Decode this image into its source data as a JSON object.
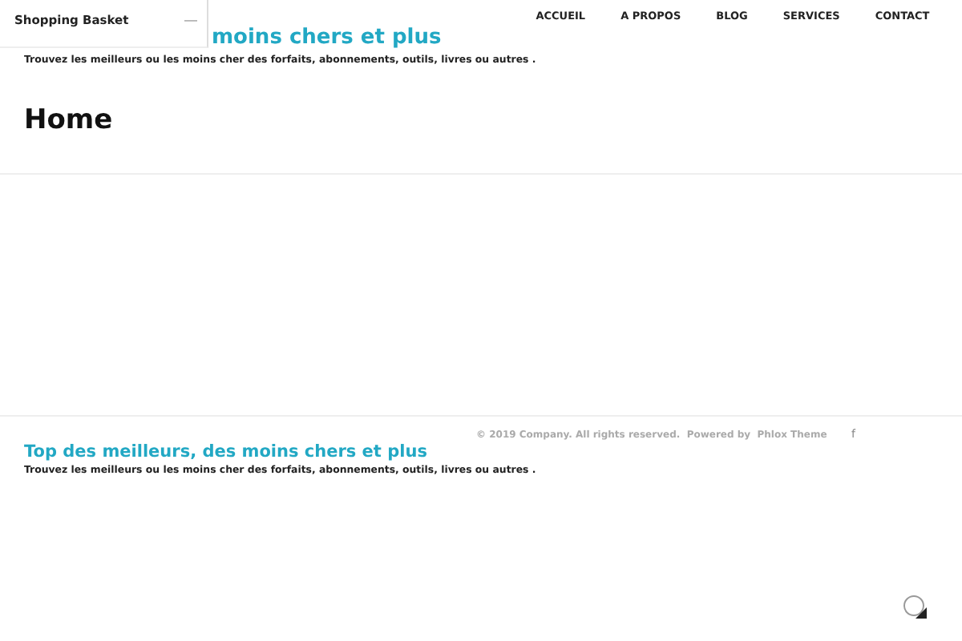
{
  "header": {
    "title_visible": "moins chers et plus",
    "tagline": "Trouvez les meilleurs ou les moins cher des forfaits, abonnements, outils, livres ou autres ."
  },
  "nav": [
    {
      "label": "ACCUEIL"
    },
    {
      "label": "A PROPOS"
    },
    {
      "label": "BLOG"
    },
    {
      "label": "SERVICES"
    },
    {
      "label": "CONTACT"
    }
  ],
  "basket": {
    "title": "Shopping Basket",
    "toggle": "—"
  },
  "page_title": "Home",
  "footer": {
    "title": "Top des meilleurs, des moins chers et plus",
    "tagline": "Trouvez les meilleurs ou les moins cher des forfaits, abonnements, outils, livres ou autres .",
    "copyright": "© 2019 Company. All rights reserved.  Powered by  Phlox Theme",
    "social": "f"
  }
}
